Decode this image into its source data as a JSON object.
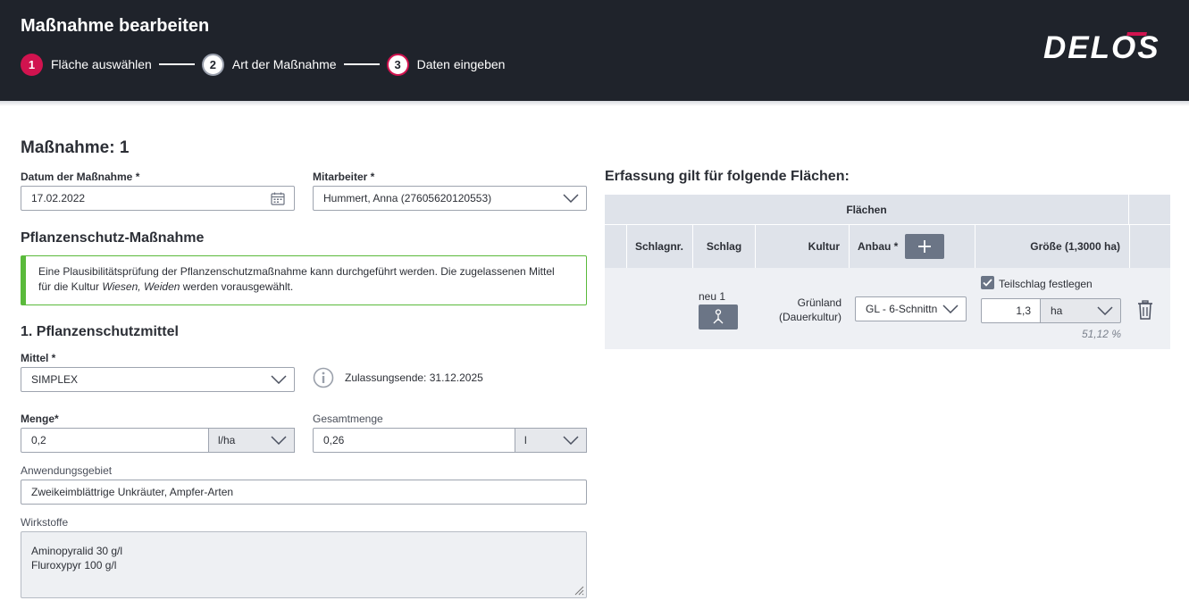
{
  "header": {
    "title": "Maßnahme bearbeiten",
    "steps": [
      {
        "num": "1",
        "label": "Fläche auswählen"
      },
      {
        "num": "2",
        "label": "Art der Maßnahme"
      },
      {
        "num": "3",
        "label": "Daten eingeben"
      }
    ],
    "logo": "DELOS"
  },
  "form": {
    "title": "Maßnahme: 1",
    "date_label": "Datum der Maßnahme *",
    "date_value": "17.02.2022",
    "employee_label": "Mitarbeiter *",
    "employee_value": "Hummert, Anna (27605620120553)",
    "section_title": "Pflanzenschutz-Maßnahme",
    "notice_line1": "Eine Plausibilitätsprüfung der Pflanzenschutzmaßnahme kann durchgeführt werden. Die zugelassenen Mittel",
    "notice_pre": "für die Kultur ",
    "notice_culture": "Wiesen, Weiden",
    "notice_post": " werden vorausgewählt.",
    "sub_title": "1. Pflanzenschutzmittel",
    "product_label": "Mittel *",
    "product_value": "SIMPLEX",
    "approval_text": "Zulassungsende: 31.12.2025",
    "amount_label": "Menge*",
    "amount_value": "0,2",
    "amount_unit": "l/ha",
    "total_label": "Gesamtmenge",
    "total_value": "0,26",
    "total_unit": "l",
    "area_label": "Anwendungsgebiet",
    "area_value": "Zweikeimblättrige Unkräuter, Ampfer-Arten",
    "ingredients_label": "Wirkstoffe",
    "ingredients_line1": "Aminopyralid 30 g/l",
    "ingredients_line2": "Fluroxypyr 100 g/l"
  },
  "table": {
    "title": "Erfassung gilt für folgende Flächen:",
    "group_header": "Flächen",
    "columns": {
      "schlagnr": "Schlagnr.",
      "schlag": "Schlag",
      "kultur": "Kultur",
      "anbau": "Anbau *",
      "groesse": "Größe (1,3000 ha)"
    },
    "row": {
      "schlag": "neu 1",
      "kultur_line1": "Grünland",
      "kultur_line2": "(Dauerkultur)",
      "anbau": "GL - 6-Schnittn",
      "teilschlag_label": "Teilschlag festlegen",
      "teilschlag_checked": true,
      "size_value": "1,3",
      "size_unit": "ha",
      "percent": "51,12 %"
    }
  },
  "colors": {
    "header_bg": "#1f232b",
    "accent": "#d1134f",
    "success": "#5aba3b",
    "table_header": "#dfe3ea",
    "button": "#6b7586"
  }
}
